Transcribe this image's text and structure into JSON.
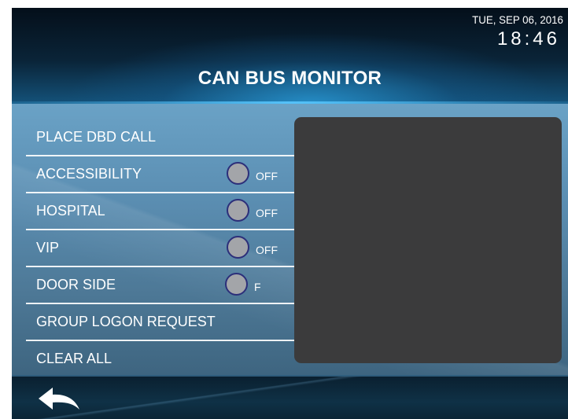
{
  "header": {
    "date": "TUE, SEP 06, 2016",
    "time": "18:46",
    "title": "CAN BUS MONITOR"
  },
  "menu": {
    "items": [
      {
        "label": "PLACE DBD CALL"
      },
      {
        "label": "ACCESSIBILITY",
        "toggle_state": "OFF"
      },
      {
        "label": "HOSPITAL",
        "toggle_state": "OFF"
      },
      {
        "label": "VIP",
        "toggle_state": "OFF"
      },
      {
        "label": "DOOR SIDE",
        "toggle_state": "F"
      },
      {
        "label": "GROUP LOGON REQUEST"
      },
      {
        "label": "CLEAR ALL"
      }
    ]
  },
  "footer": {
    "back_icon": "back-arrow-icon"
  },
  "colors": {
    "toggle_fill": "#a3a5a9",
    "toggle_border": "#2c2f7a",
    "monitor_panel": "#3b3b3c",
    "header_accent": "#2896d2"
  }
}
